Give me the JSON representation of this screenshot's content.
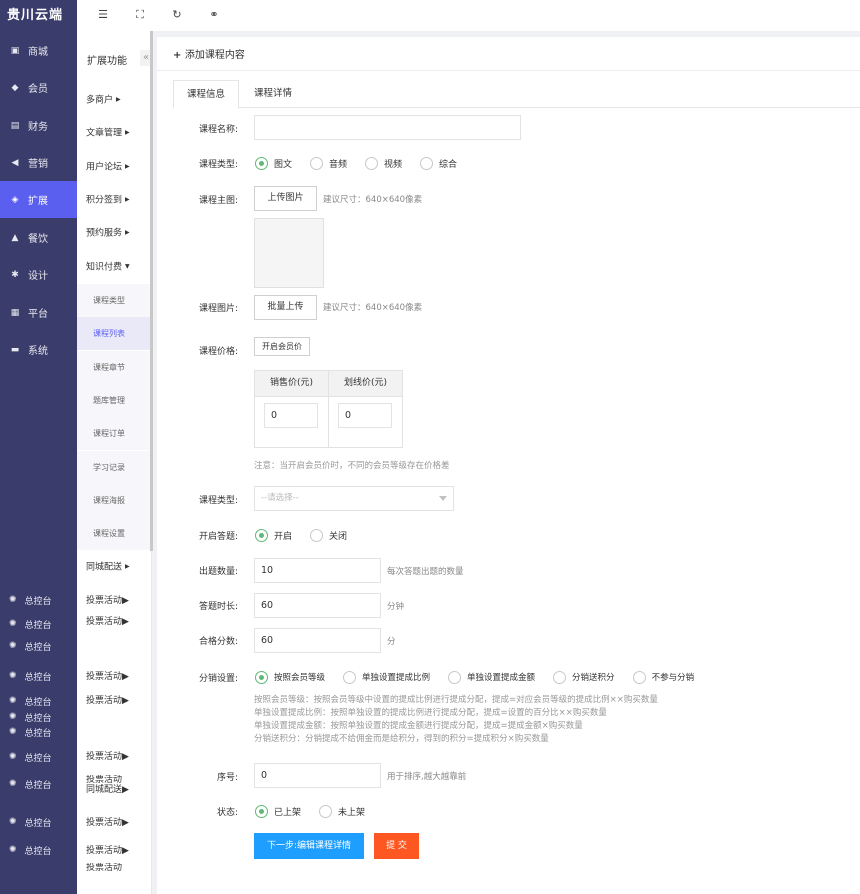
{
  "brand": "贵川云端",
  "sidebar": {
    "items": [
      {
        "label": "商城",
        "icon": "shop-icon"
      },
      {
        "label": "会员",
        "icon": "member-icon"
      },
      {
        "label": "财务",
        "icon": "finance-icon"
      },
      {
        "label": "营销",
        "icon": "megaphone-icon"
      },
      {
        "label": "扩展",
        "icon": "cube-icon"
      },
      {
        "label": "餐饮",
        "icon": "dining-icon"
      },
      {
        "label": "设计",
        "icon": "design-icon"
      },
      {
        "label": "平台",
        "icon": "grid-icon"
      },
      {
        "label": "系统",
        "icon": "system-icon"
      }
    ],
    "bottom_items": [
      "总控台",
      "总控台",
      "总控台",
      "总控台",
      "总控台",
      "总控台",
      "总控台",
      "总控台",
      "总控台",
      "总控台",
      "总控台"
    ]
  },
  "subnav": {
    "title": "扩展功能",
    "collapse": "«",
    "items": [
      "多商户",
      "文章管理",
      "用户论坛",
      "积分签到",
      "预约服务",
      "知识付费"
    ],
    "children": [
      "课程类型",
      "课程列表",
      "课程章节",
      "题库管理",
      "课程订单",
      "学习记录",
      "课程海报",
      "课程设置"
    ],
    "after": "同城配送",
    "bottom_items": [
      "投票活动",
      "投票活动",
      "投票活动",
      "投票活动",
      "投票活动",
      "投票活动",
      "同城配送",
      "投票活动",
      "投票活动",
      "投票活动"
    ]
  },
  "topbar": {
    "icons": [
      "menu-fold-icon",
      "fullscreen-icon",
      "refresh-icon",
      "link-icon"
    ]
  },
  "main": {
    "add_title": "添加课程内容",
    "tabs": [
      "课程信息",
      "课程详情"
    ],
    "form": {
      "name_label": "课程名称:",
      "type_label": "课程类型:",
      "type_options": [
        "图文",
        "音频",
        "视频",
        "综合"
      ],
      "main_img_label": "课程主图:",
      "upload_btn": "上传图片",
      "size_hint": "建议尺寸：640×640像素",
      "img_label": "课程图片:",
      "batch_upload_btn": "批量上传",
      "size_hint2": "建议尺寸：640×640像素",
      "price_label": "课程价格:",
      "member_price_btn": "开启会员价",
      "price_headers": [
        "销售价(元)",
        "划线价(元)"
      ],
      "price_values": [
        "0",
        "0"
      ],
      "price_note": "注意：当开启会员价时，不同的会员等级存在价格差",
      "category_label": "课程类型:",
      "category_placeholder": "--请选择--",
      "quiz_label": "开启答题:",
      "quiz_options": [
        "开启",
        "关闭"
      ],
      "count_label": "出题数量:",
      "count_value": "10",
      "count_hint": "每次答题出题的数量",
      "duration_label": "答题时长:",
      "duration_value": "60",
      "duration_unit": "分钟",
      "pass_label": "合格分数:",
      "pass_value": "60",
      "pass_unit": "分",
      "dist_label": "分销设置:",
      "dist_options": [
        "按照会员等级",
        "单独设置提成比例",
        "单独设置提成金额",
        "分销送积分",
        "不参与分销"
      ],
      "dist_notes": [
        "按照会员等级：按照会员等级中设置的提成比例进行提成分配，提成=对应会员等级的提成比例××购买数量",
        "单独设置提成比例：按照单独设置的提成比例进行提成分配，提成=设置的百分比××购买数量",
        "单独设置提成金额：按照单独设置的提成金额进行提成分配，提成=提成金额×购买数量",
        "分销送积分：分销提成不给佣金而是给积分，得到的积分=提成积分×购买数量"
      ],
      "order_label": "序号:",
      "order_value": "0",
      "order_hint": "用于排序,越大越靠前",
      "status_label": "状态:",
      "status_options": [
        "已上架",
        "未上架"
      ],
      "next_btn": "下一步:编辑课程详情",
      "submit_btn": "提 交"
    }
  }
}
